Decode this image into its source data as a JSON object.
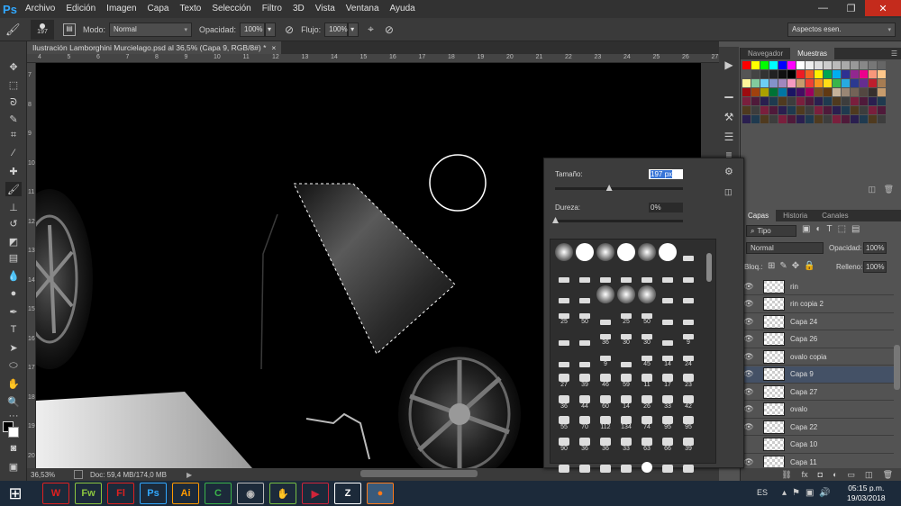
{
  "app": {
    "logo": "Ps"
  },
  "menu": [
    "Archivo",
    "Edición",
    "Imagen",
    "Capa",
    "Texto",
    "Selección",
    "Filtro",
    "3D",
    "Vista",
    "Ventana",
    "Ayuda"
  ],
  "options": {
    "brush_size": "197",
    "mode_label": "Modo:",
    "mode_value": "Normal",
    "opacity_label": "Opacidad:",
    "opacity_value": "100%",
    "flow_label": "Flujo:",
    "flow_value": "100%",
    "workspace": "Aspectos esen."
  },
  "document": {
    "tab_title": "Ilustración Lamborghini Murcielago.psd al 36,5% (Capa 9, RGB/8#) *",
    "close": "×"
  },
  "ruler": {
    "top": [
      "4",
      "5",
      "6",
      "7",
      "8",
      "9",
      "10",
      "11",
      "12",
      "13",
      "14",
      "15",
      "16",
      "17",
      "18",
      "19",
      "20",
      "21",
      "22",
      "23",
      "24",
      "25",
      "26",
      "27"
    ],
    "left": [
      "7",
      "8",
      "9",
      "10",
      "11",
      "12",
      "13",
      "14",
      "15",
      "16",
      "17",
      "18",
      "19",
      "20"
    ]
  },
  "status": {
    "zoom": "36,53%",
    "doc": "Doc: 59,4 MB/174,0 MB"
  },
  "brush_picker": {
    "size_label": "Tamaño:",
    "size_value": "197 px",
    "hardness_label": "Dureza:",
    "hardness_value": "0%",
    "size_level": 0.42,
    "hardness_level": 0.0,
    "presets": [
      {
        "n": ""
      },
      {
        "n": ""
      },
      {
        "n": ""
      },
      {
        "n": ""
      },
      {
        "n": ""
      },
      {
        "n": ""
      },
      {
        "n": ""
      },
      {
        "n": ""
      },
      {
        "n": ""
      },
      {
        "n": ""
      },
      {
        "n": ""
      },
      {
        "n": ""
      },
      {
        "n": ""
      },
      {
        "n": ""
      },
      {
        "n": ""
      },
      {
        "n": ""
      },
      {
        "n": ""
      },
      {
        "n": ""
      },
      {
        "n": ""
      },
      {
        "n": ""
      },
      {
        "n": ""
      },
      {
        "n": "25"
      },
      {
        "n": "50"
      },
      {
        "n": ""
      },
      {
        "n": "25"
      },
      {
        "n": "50"
      },
      {
        "n": ""
      },
      {
        "n": ""
      },
      {
        "n": ""
      },
      {
        "n": ""
      },
      {
        "n": "36"
      },
      {
        "n": "30"
      },
      {
        "n": "30"
      },
      {
        "n": ""
      },
      {
        "n": "9"
      },
      {
        "n": ""
      },
      {
        "n": ""
      },
      {
        "n": "9"
      },
      {
        "n": ""
      },
      {
        "n": "45"
      },
      {
        "n": "14"
      },
      {
        "n": "24"
      },
      {
        "n": "27"
      },
      {
        "n": "39"
      },
      {
        "n": "46"
      },
      {
        "n": "59"
      },
      {
        "n": "11"
      },
      {
        "n": "17"
      },
      {
        "n": "23"
      },
      {
        "n": "36"
      },
      {
        "n": "44"
      },
      {
        "n": "60"
      },
      {
        "n": "14"
      },
      {
        "n": "26"
      },
      {
        "n": "33"
      },
      {
        "n": "42"
      },
      {
        "n": "55"
      },
      {
        "n": "70"
      },
      {
        "n": "112"
      },
      {
        "n": "134"
      },
      {
        "n": "74"
      },
      {
        "n": "95"
      },
      {
        "n": "95"
      },
      {
        "n": "90"
      },
      {
        "n": "36"
      },
      {
        "n": "36"
      },
      {
        "n": "33"
      },
      {
        "n": "63"
      },
      {
        "n": "66"
      },
      {
        "n": "39"
      },
      {
        "n": ""
      },
      {
        "n": ""
      },
      {
        "n": ""
      },
      {
        "n": ""
      },
      {
        "n": ""
      },
      {
        "n": ""
      },
      {
        "n": ""
      }
    ]
  },
  "swatches_panel": {
    "tabs": [
      "Navegador",
      "Muestras"
    ]
  },
  "layers_panel": {
    "tabs": [
      "Capas",
      "Historia",
      "Canales"
    ],
    "filter": "Tipo",
    "blend": "Normal",
    "opacity_label": "Opacidad:",
    "opacity_value": "100%",
    "lock_label": "Bloq.:",
    "fill_label": "Relleno:",
    "fill_value": "100%",
    "layers": [
      {
        "name": "rin",
        "visible": true
      },
      {
        "name": "rin copia 2",
        "visible": true
      },
      {
        "name": "Capa 24",
        "visible": true
      },
      {
        "name": "Capa 26",
        "visible": true
      },
      {
        "name": "ovalo copia",
        "visible": true
      },
      {
        "name": "Capa 9",
        "visible": true,
        "selected": true
      },
      {
        "name": "Capa 27",
        "visible": true
      },
      {
        "name": "ovalo",
        "visible": true
      },
      {
        "name": "Capa 22",
        "visible": true
      },
      {
        "name": "Capa 10",
        "visible": false
      },
      {
        "name": "Capa 11",
        "visible": true
      }
    ]
  },
  "taskbar": {
    "lang": "ES",
    "time": "05:15 p.m.",
    "date": "19/03/2018",
    "apps": [
      {
        "label": "W",
        "color": "#e02020"
      },
      {
        "label": "Fw",
        "color": "#8bc53f"
      },
      {
        "label": "Fl",
        "color": "#e0201f"
      },
      {
        "label": "Ps",
        "color": "#31a8ff"
      },
      {
        "label": "Ai",
        "color": "#ff9a00"
      },
      {
        "label": "C",
        "color": "#3bb34a"
      },
      {
        "label": "◉",
        "color": "#bbbbbb"
      },
      {
        "label": "✋",
        "color": "#77c043"
      },
      {
        "label": "▶",
        "color": "#d0243a"
      },
      {
        "label": "Z",
        "color": "#ffffff"
      },
      {
        "label": "●",
        "color": "#ff7a1a"
      }
    ]
  }
}
